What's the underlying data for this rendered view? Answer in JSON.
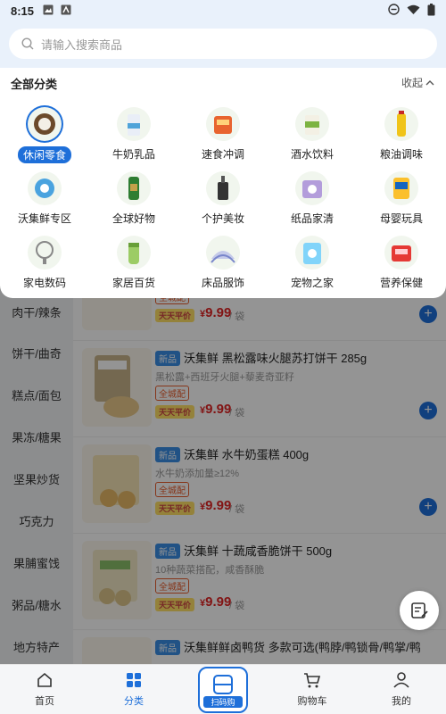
{
  "status": {
    "time": "8:15"
  },
  "search": {
    "placeholder": "请输入搜索商品"
  },
  "sheet": {
    "title": "全部分类",
    "collapse_label": "收起",
    "categories": [
      {
        "label": "休闲零食",
        "icon": "snack-icon",
        "active": true
      },
      {
        "label": "牛奶乳品",
        "icon": "milk-icon"
      },
      {
        "label": "速食冲调",
        "icon": "instant-food-icon"
      },
      {
        "label": "酒水饮料",
        "icon": "beverage-icon"
      },
      {
        "label": "粮油调味",
        "icon": "grain-oil-icon"
      },
      {
        "label": "沃集鲜专区",
        "icon": "fresh-zone-icon"
      },
      {
        "label": "全球好物",
        "icon": "global-goods-icon"
      },
      {
        "label": "个护美妆",
        "icon": "beauty-icon"
      },
      {
        "label": "纸品家清",
        "icon": "paper-cleaning-icon"
      },
      {
        "label": "母婴玩具",
        "icon": "baby-toy-icon"
      },
      {
        "label": "家电数码",
        "icon": "appliance-icon"
      },
      {
        "label": "家居百货",
        "icon": "home-goods-icon"
      },
      {
        "label": "床品服饰",
        "icon": "bedding-icon"
      },
      {
        "label": "宠物之家",
        "icon": "pet-icon"
      },
      {
        "label": "营养保健",
        "icon": "health-icon"
      }
    ]
  },
  "left_nav": [
    "肉干/辣条",
    "饼干/曲奇",
    "糕点/面包",
    "果冻/糖果",
    "坚果炒货",
    "巧克力",
    "果脯蜜饯",
    "粥品/糖水",
    "地方特产"
  ],
  "products": [
    {
      "new": "",
      "title": "",
      "desc": "",
      "badge": "全城配",
      "daily": "天天平价",
      "yen": "¥",
      "price": "9.99",
      "unit": "/ 袋"
    },
    {
      "new": "新品",
      "title": "沃集鲜 黑松露味火腿苏打饼干 285g",
      "desc": "黑松露+西班牙火腿+藜麦奇亚籽",
      "badge": "全城配",
      "daily": "天天平价",
      "yen": "¥",
      "price": "9.99",
      "unit": "/ 袋"
    },
    {
      "new": "新品",
      "title": "沃集鲜 水牛奶蛋糕 400g",
      "desc": "水牛奶添加量≥12%",
      "badge": "全城配",
      "daily": "天天平价",
      "yen": "¥",
      "price": "9.99",
      "unit": "/ 袋"
    },
    {
      "new": "新品",
      "title": "沃集鲜 十蔬咸香脆饼干 500g",
      "desc": "10种蔬菜搭配，咸香酥脆",
      "badge": "全城配",
      "daily": "天天平价",
      "yen": "¥",
      "price": "9.99",
      "unit": "/ 袋"
    },
    {
      "new": "新品",
      "title": "沃集鲜鲜卤鸭货 多款可选(鸭脖/鸭锁骨/鸭掌/鸭",
      "desc": "",
      "badge": "",
      "daily": "",
      "yen": "",
      "price": "",
      "unit": ""
    }
  ],
  "bottom_nav": {
    "home": "首页",
    "category": "分类",
    "scan": "扫码购",
    "cart": "购物车",
    "mine": "我的"
  },
  "colors": {
    "accent": "#1e6fd9",
    "price": "#e02424"
  }
}
